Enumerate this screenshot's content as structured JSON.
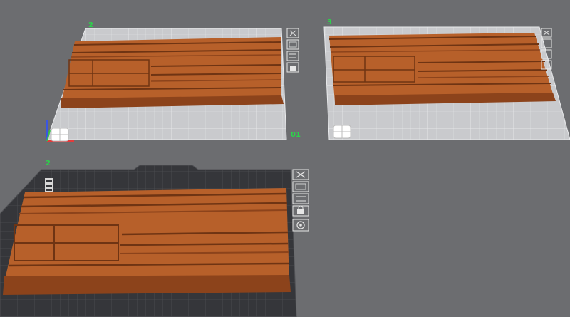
{
  "scene": {
    "background": "#6c6d70",
    "plates": [
      {
        "id": "plate-1",
        "number_label": "2",
        "extra_label": "01",
        "style": "light"
      },
      {
        "id": "plate-2",
        "number_label": "3",
        "style": "light"
      },
      {
        "id": "plate-3",
        "number_label": "2",
        "style": "dark"
      }
    ],
    "plate_tools": [
      "close-icon",
      "arrange-icon",
      "orient-icon",
      "lock-icon",
      "settings-icon"
    ],
    "colors": {
      "model_top": "#b7602a",
      "model_side": "#8c431b",
      "model_groove": "#6f3413",
      "bed_light": "#d0d1d4",
      "bed_dark": "#3a3b3e",
      "label_green": "#2bd34a",
      "axis_x": "#e23b3b",
      "axis_y": "#33c24a",
      "axis_z": "#3b56e2"
    }
  }
}
